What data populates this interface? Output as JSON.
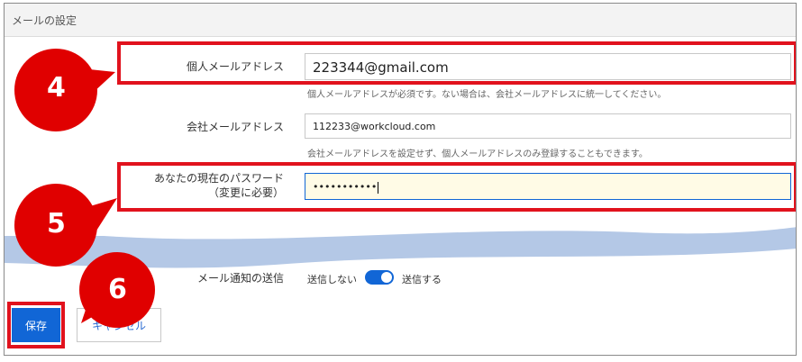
{
  "section": {
    "title": "メールの設定"
  },
  "personal_email": {
    "label": "個人メールアドレス",
    "value": "223344@gmail.com",
    "hint": "個人メールアドレスが必須です。ない場合は、会社メールアドレスに統一してください。"
  },
  "company_email": {
    "label": "会社メールアドレス",
    "value": "112233@workcloud.com",
    "hint": "会社メールアドレスを設定せず、個人メールアドレスのみ登録することもできます。"
  },
  "password": {
    "label_line1": "あなたの現在のパスワード",
    "label_line2": "（変更に必要）",
    "value": "•••••••••••"
  },
  "notification": {
    "label": "メール通知の送信",
    "off_label": "送信しない",
    "on_label": "送信する",
    "enabled": true
  },
  "buttons": {
    "save": "保存",
    "cancel": "キャンセル"
  },
  "callouts": {
    "c4": "4",
    "c5": "5",
    "c6": "6"
  },
  "colors": {
    "accent": "#1166d6",
    "highlight": "#e1121d",
    "callout": "#e00000",
    "wave": "#b4c8e6"
  }
}
